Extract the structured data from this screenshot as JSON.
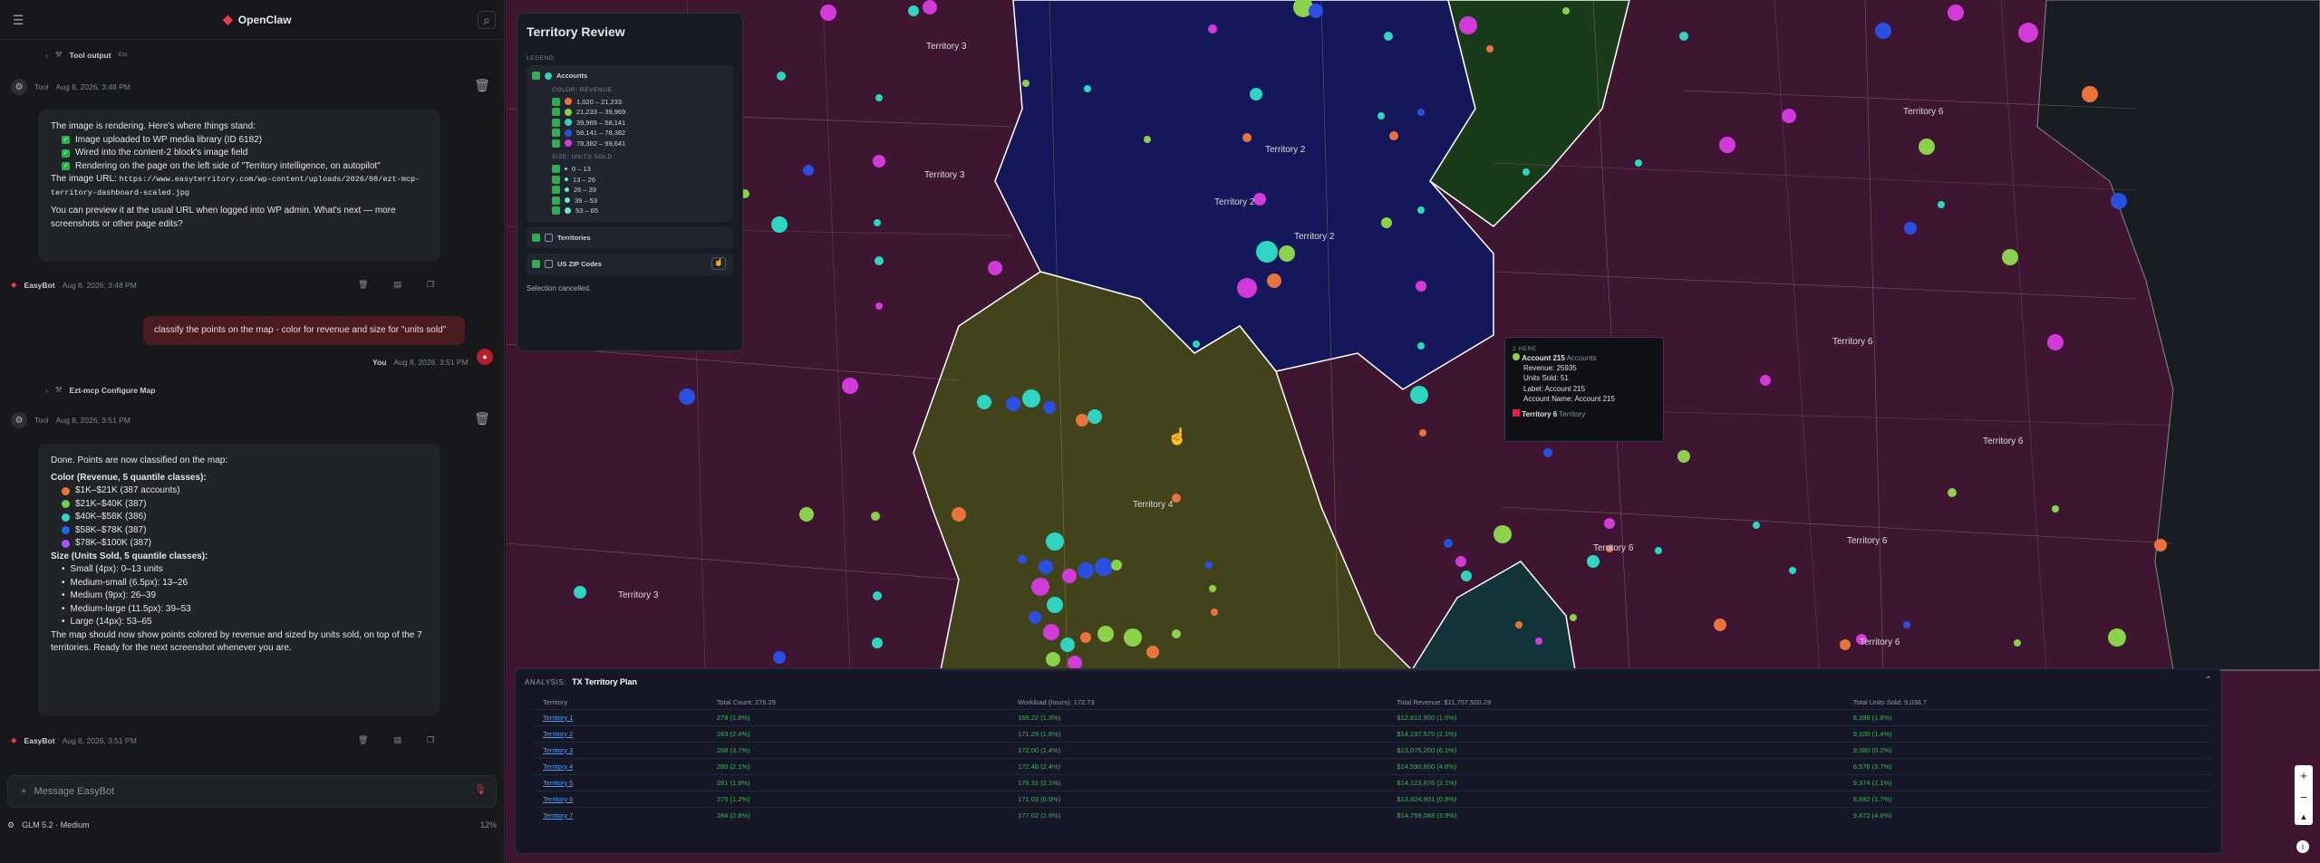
{
  "app": {
    "brand": "OpenClaw"
  },
  "chat": {
    "tool_output": {
      "label": "Tool output",
      "badge": "Ezc"
    },
    "msg1": {
      "author": "Tool",
      "time": "Aug 8, 2026, 3:48 PM",
      "intro": "The image is rendering. Here's where things stand:",
      "items": [
        "Image uploaded to WP media library (ID 6182)",
        "Wired into the content-2 block's image field",
        "Rendering on the page on the left side of \"Territory intelligence, on autopilot\""
      ],
      "url_label": "The image URL:",
      "url": "https://www.easyterritory.com/wp-content/uploads/2026/08/ezt-mcp-territory-dashboard-scaled.jpg",
      "outro": "You can preview it at the usual URL when logged into WP admin. What's next — more screenshots or other page edits?"
    },
    "footer1": {
      "author": "EasyBot",
      "time": "Aug 8, 2026, 3:48 PM"
    },
    "user": {
      "text": "classify the points on the map - color for revenue and size for \"units sold\"",
      "author": "You",
      "time": "Aug 8, 2026, 3:51 PM"
    },
    "tool2": {
      "label": "Ezt-mcp Configure Map"
    },
    "msg2": {
      "author": "Tool",
      "time": "Aug 8, 2026, 3:51 PM",
      "intro": "Done. Points are now classified on the map:",
      "color_head": "Color (Revenue, 5 quantile classes):",
      "colors": [
        {
          "label": "$1K–$21K (387 accounts)",
          "color": "#e8743b"
        },
        {
          "label": "$21K–$40K (387)",
          "color": "#74d14c"
        },
        {
          "label": "$40K–$58K (386)",
          "color": "#2fd5c0"
        },
        {
          "label": "$58K–$78K (387)",
          "color": "#2563eb"
        },
        {
          "label": "$78K–$100K (387)",
          "color": "#a855f7"
        }
      ],
      "size_head": "Size (Units Sold, 5 quantile classes):",
      "sizes": [
        "Small (4px): 0–13 units",
        "Medium-small (6.5px): 13–26",
        "Medium (9px): 26–39",
        "Medium-large (11.5px): 39–53",
        "Large (14px): 53–65"
      ],
      "outro": "The map should now show points colored by revenue and sized by units sold, on top of the 7 territories. Ready for the next screenshot whenever you are."
    },
    "footer2": {
      "author": "EasyBot",
      "time": "Aug 8, 2026, 3:51 PM"
    },
    "composer": {
      "placeholder": "Message EasyBot"
    },
    "model": {
      "name": "GLM 5.2 · Medium",
      "usage": "12%"
    }
  },
  "legend": {
    "title": "Territory Review",
    "section": "LEGEND",
    "accounts": "Accounts",
    "color_label": "COLOR: REVENUE",
    "colors": [
      {
        "label": "1,020 – 21,233",
        "color": "#e8743b"
      },
      {
        "label": "21,233 – 39,969",
        "color": "#8bd14c"
      },
      {
        "label": "39,969 – 58,141",
        "color": "#2fd5c0"
      },
      {
        "label": "58,141 – 78,382",
        "color": "#2b4fe0"
      },
      {
        "label": "78,382 – 99,641",
        "color": "#d23bd9"
      }
    ],
    "size_label": "SIZE: UNITS SOLD",
    "sizes": [
      "0 – 13",
      "13 – 26",
      "26 – 39",
      "39 – 53",
      "53 – 65"
    ],
    "territories": "Territories",
    "zip": "US ZIP Codes",
    "status": "Selection cancelled."
  },
  "tooltip": {
    "here": "2 HERE",
    "account": "Account 215",
    "account_type": "Accounts",
    "revenue": "Revenue: 25935",
    "units": "Units Sold: 51",
    "label": "Label: Account 215",
    "name": "Account Name: Account 215",
    "territory": "Territory 6",
    "territory_type": "Territory"
  },
  "analysis": {
    "prefix": "ANALYSIS:",
    "title": "TX Territory Plan",
    "columns": [
      "Territory",
      "Total Count: 276.29",
      "Workload (hours): 172.73",
      "Total Revenue: $11,757,500.29",
      "Total Units Sold: 9,036.7"
    ],
    "rows": [
      [
        "Territory 1",
        "278 (1.8%)",
        "169.22 (1.3%)",
        "$12,812,900 (1.6%)",
        "8,399 (1.8%)"
      ],
      [
        "Territory 2",
        "283 (2.4%)",
        "171.29 (1.6%)",
        "$14,237,575 (2.1%)",
        "9,100 (1.4%)"
      ],
      [
        "Territory 3",
        "266 (3.7%)",
        "172.00 (1.4%)",
        "$13,075,200 (6.1%)",
        "9,380 (0.2%)"
      ],
      [
        "Territory 4",
        "280 (2.1%)",
        "172.48 (2.4%)",
        "$14,590,800 (4.6%)",
        "8,576 (3.7%)"
      ],
      [
        "Territory 5",
        "281 (1.9%)",
        "176.31 (2.1%)",
        "$14,123,676 (2.1%)",
        "9,374 (1.1%)"
      ],
      [
        "Territory 6",
        "275 (1.2%)",
        "171.03 (0.9%)",
        "$13,824,901 (0.8%)",
        "8,882 (1.7%)"
      ],
      [
        "Territory 7",
        "284 (2.8%)",
        "177.02 (2.9%)",
        "$14,759,088 (3.9%)",
        "9,472 (4.8%)"
      ]
    ]
  },
  "map_labels": [
    "Territory 3",
    "Territory 2",
    "Territory 2",
    "Territory 2",
    "Territory 3",
    "Territory 6",
    "Territory 6",
    "Territory 4",
    "Territory 6",
    "Territory 6",
    "Territory 3",
    "Territory 6",
    "Territory 6"
  ]
}
